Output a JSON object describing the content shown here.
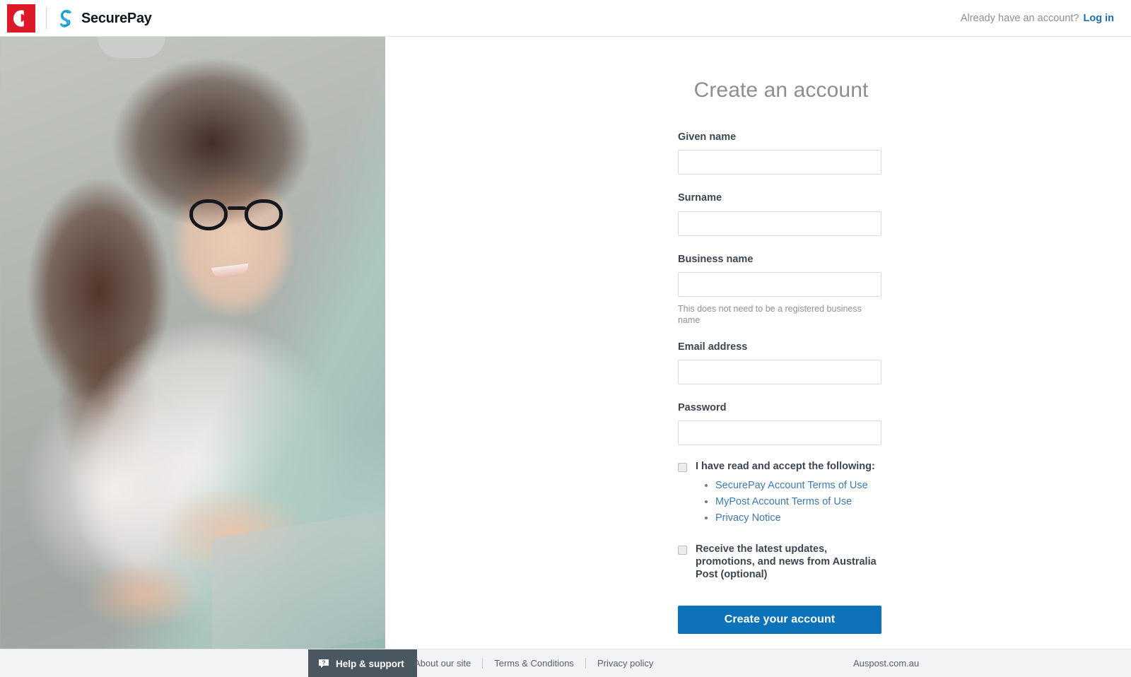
{
  "header": {
    "ap_logo_name": "australia-post-logo",
    "securepay_logo_name": "securepay-logo",
    "brand_name": "SecurePay",
    "account_prompt": "Already have an account?",
    "login_label": "Log in",
    "accent_red": "#dc1928",
    "accent_blue": "#29abe2"
  },
  "hero": {
    "alt": "Woman with glasses smiling while typing on a laptop"
  },
  "form": {
    "title": "Create an account",
    "fields": [
      {
        "label": "Given name",
        "value": "",
        "placeholder": "",
        "type": "text",
        "help": ""
      },
      {
        "label": "Surname",
        "value": "",
        "placeholder": "",
        "type": "text",
        "help": ""
      },
      {
        "label": "Business name",
        "value": "",
        "placeholder": "",
        "type": "text",
        "help": "This does not need to be a registered business name"
      },
      {
        "label": "Email address",
        "value": "",
        "placeholder": "",
        "type": "email",
        "help": ""
      },
      {
        "label": "Password",
        "value": "",
        "placeholder": "",
        "type": "password",
        "help": ""
      }
    ],
    "terms": {
      "checkbox_label": "I have read and accept the following:",
      "checked": false,
      "links": [
        "SecurePay Account Terms of Use",
        "MyPost Account Terms of Use",
        "Privacy Notice"
      ]
    },
    "marketing": {
      "checkbox_label": "Receive the latest updates, promotions, and news from Australia Post (optional)",
      "checked": false
    },
    "submit_label": "Create your account",
    "submit_color": "#0d72b9"
  },
  "footer": {
    "help_label": "Help & support",
    "help_icon": "help-speech-bubble-icon",
    "links": [
      "About our site",
      "Terms & Conditions",
      "Privacy policy"
    ],
    "site_label": "Auspost.com.au"
  }
}
